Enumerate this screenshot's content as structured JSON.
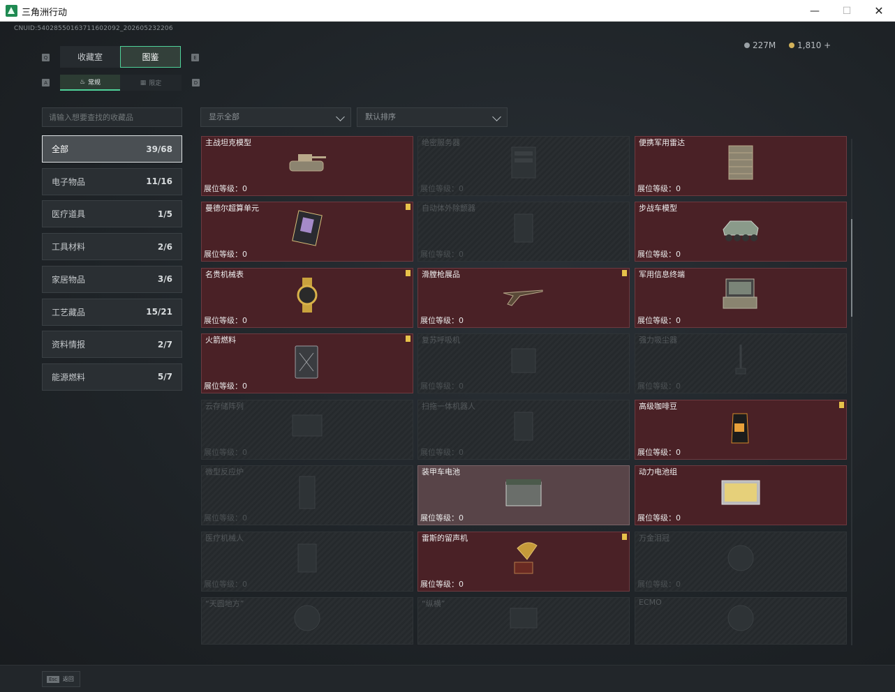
{
  "window": {
    "title": "三角洲行动",
    "minimize": "—",
    "maximize": "☐",
    "close": "✕"
  },
  "header": {
    "cnuid": "CNUID:5402855016371160209​2_202605232206",
    "currency": [
      {
        "name": "coin-silver",
        "value": "227M"
      },
      {
        "name": "coin-gold",
        "value": "1,810 +"
      }
    ]
  },
  "tabs": [
    {
      "label": "收藏室",
      "active": false
    },
    {
      "label": "图鉴",
      "active": true
    }
  ],
  "tab_keys": {
    "left": "Q",
    "right": "E",
    "sub_left": "A",
    "sub_right": "D"
  },
  "subtabs": [
    {
      "label": "常规",
      "icon": "flame-icon",
      "active": true
    },
    {
      "label": "限定",
      "icon": "grid-icon",
      "active": false
    }
  ],
  "search": {
    "placeholder": "请输入想要查找的收藏品"
  },
  "filters": {
    "show": "显示全部",
    "sort": "默认排序"
  },
  "categories": [
    {
      "label": "全部",
      "count": "39/68",
      "active": true
    },
    {
      "label": "电子物品",
      "count": "11/16",
      "active": false
    },
    {
      "label": "医疗道具",
      "count": "1/5",
      "active": false
    },
    {
      "label": "工具材料",
      "count": "2/6",
      "active": false
    },
    {
      "label": "家居物品",
      "count": "3/6",
      "active": false
    },
    {
      "label": "工艺藏品",
      "count": "15/21",
      "active": false
    },
    {
      "label": "资料情报",
      "count": "2/7",
      "active": false
    },
    {
      "label": "能源燃料",
      "count": "5/7",
      "active": false
    }
  ],
  "level_label": "展位等级：0",
  "items": [
    {
      "name": "主战坦克模型",
      "owned": true,
      "badge": false,
      "icon": "tank-icon"
    },
    {
      "name": "绝密服务器",
      "owned": false,
      "badge": false,
      "icon": "server-icon"
    },
    {
      "name": "便携军用雷达",
      "owned": true,
      "badge": false,
      "icon": "radar-icon"
    },
    {
      "name": "曼德尔超算单元",
      "owned": true,
      "badge": true,
      "icon": "chip-icon"
    },
    {
      "name": "自动体外除颤器",
      "owned": false,
      "badge": false,
      "icon": "defibrillator-icon"
    },
    {
      "name": "步战车模型",
      "owned": true,
      "badge": false,
      "icon": "ifv-icon"
    },
    {
      "name": "名贵机械表",
      "owned": true,
      "badge": true,
      "icon": "watch-icon"
    },
    {
      "name": "滑膛枪展品",
      "owned": true,
      "badge": true,
      "icon": "musket-icon"
    },
    {
      "name": "军用信息终端",
      "owned": true,
      "badge": false,
      "icon": "terminal-icon"
    },
    {
      "name": "火箭燃料",
      "owned": true,
      "badge": true,
      "icon": "jerrycan-icon"
    },
    {
      "name": "复苏呼吸机",
      "owned": false,
      "badge": false,
      "icon": "ventilator-icon"
    },
    {
      "name": "强力吸尘器",
      "owned": false,
      "badge": false,
      "icon": "vacuum-icon"
    },
    {
      "name": "云存储阵列",
      "owned": false,
      "badge": false,
      "icon": "storage-icon"
    },
    {
      "name": "扫拖一体机器人",
      "owned": false,
      "badge": false,
      "icon": "robot-icon"
    },
    {
      "name": "高级咖啡豆",
      "owned": true,
      "badge": true,
      "icon": "coffee-icon"
    },
    {
      "name": "微型反应炉",
      "owned": false,
      "badge": false,
      "icon": "reactor-icon"
    },
    {
      "name": "装甲车电池",
      "owned": true,
      "badge": false,
      "icon": "battery-icon",
      "highlight": true
    },
    {
      "name": "动力电池组",
      "owned": true,
      "badge": false,
      "icon": "battery-pack-icon"
    },
    {
      "name": "医疗机械人",
      "owned": false,
      "badge": false,
      "icon": "medical-robot-icon"
    },
    {
      "name": "雷斯的留声机",
      "owned": true,
      "badge": true,
      "icon": "gramophone-icon"
    },
    {
      "name": "万金泪冠",
      "owned": false,
      "badge": false,
      "icon": "crown-icon"
    },
    {
      "name": "“天圆地方”",
      "owned": false,
      "badge": false,
      "icon": "globe-icon"
    },
    {
      "name": "“纵横”",
      "owned": false,
      "badge": false,
      "icon": "board-icon"
    },
    {
      "name": "ECMO",
      "owned": false,
      "badge": false,
      "icon": "ecmo-icon"
    }
  ],
  "footer": {
    "key": "Esc",
    "label": "返回"
  },
  "colors": {
    "accent": "#4fd39a",
    "owned_card": "#4a2126",
    "badge": "#e7c24a"
  }
}
